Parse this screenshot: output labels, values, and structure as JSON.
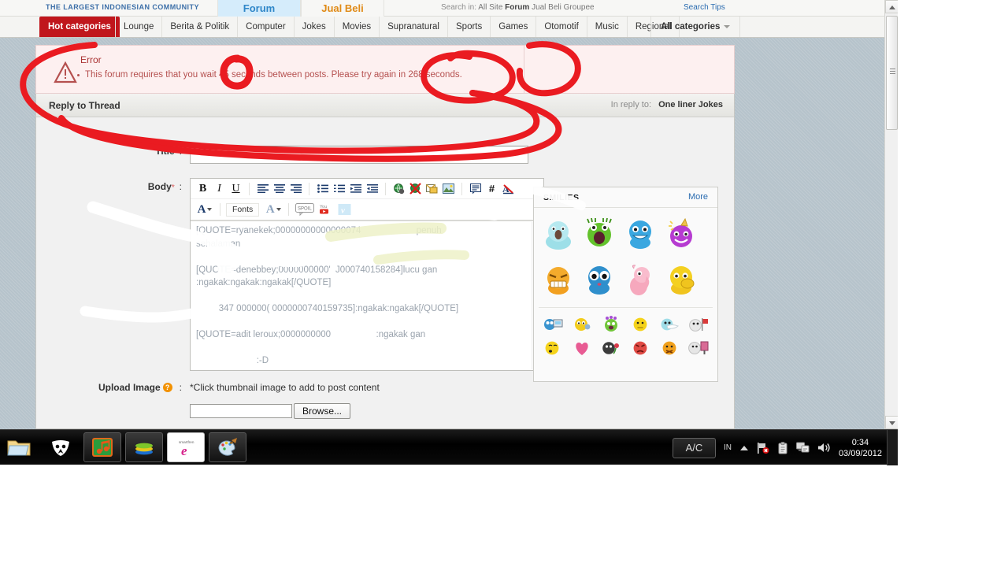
{
  "site": {
    "tagline": "THE LARGEST INDONESIAN COMMUNITY",
    "tab_forum": "Forum",
    "tab_jual_beli": "Jual Beli",
    "search_in_label": "Search in:",
    "search_scopes": [
      "All Site",
      "Forum",
      "Jual Beli",
      "Groupee"
    ],
    "search_tips": "Search Tips"
  },
  "categories": {
    "hot": "Hot categories",
    "items": [
      "Lounge",
      "Berita & Politik",
      "Computer",
      "Jokes",
      "Movies",
      "Supranatural",
      "Sports",
      "Games",
      "Otomotif",
      "Music",
      "Regional"
    ],
    "all": "All categories"
  },
  "error": {
    "heading": "Error",
    "message": "This forum requires that you wait 45 seconds between posts. Please try again in 268 seconds.",
    "wait_seconds": 45,
    "retry_seconds": 268
  },
  "reply": {
    "panel_title": "Reply to Thread",
    "in_reply_to_label": "In reply to:",
    "in_reply_to_thread": "One liner Jokes",
    "title_label": "Title",
    "title_value": "",
    "body_label": "Body",
    "body_required_mark": "*",
    "colon": ":",
    "body_value": "[QUOTE=ryanekek;00000000000000074                      penuh\nsehalaman\n\n[QUOTE=denebbey;0000000000'  J000740158284]lucu gan\n:ngakak:ngakak:ngakak[/QUOTE]\n\n         347 000000( 0000000740159735]:ngakak:ngakak[/QUOTE]\n\n[QUOTE=adit leroux;0000000000                  :ngakak gan\n\n                        :-D"
  },
  "toolbar": {
    "row1": [
      "bold-icon",
      "italic-icon",
      "underline-icon",
      "align-left-icon",
      "align-center-icon",
      "align-right-icon",
      "bullet-list-icon",
      "numbered-list-icon",
      "outdent-icon",
      "indent-icon",
      "link-icon",
      "unlink-icon",
      "email-icon",
      "image-icon",
      "quote-icon",
      "hash-icon",
      "remove-format-icon"
    ],
    "font_color_label": "A",
    "fonts_label": "Fonts",
    "font_size_label": "A",
    "spoil_label": "SPOIL",
    "youtube_label": "You",
    "vimeo_label": "v"
  },
  "smilies": {
    "title": "SMILIES",
    "more": "More",
    "big": [
      {
        "name": "shocked-cyan-smiley",
        "glyph": "😨"
      },
      {
        "name": "green-monster-smiley",
        "glyph": "😱"
      },
      {
        "name": "blue-grin-smiley",
        "glyph": "😀"
      },
      {
        "name": "purple-party-smiley",
        "glyph": "🥳"
      },
      {
        "name": "orange-evil-grin-smiley",
        "glyph": "😈"
      },
      {
        "name": "blue-bigeyes-smiley",
        "glyph": "🫢"
      },
      {
        "name": "pink-elephant-smiley",
        "glyph": "🐘"
      },
      {
        "name": "yellow-shy-smiley",
        "glyph": "🙊"
      }
    ],
    "small": [
      {
        "name": "computer-smiley",
        "glyph": "💻"
      },
      {
        "name": "thinking-smiley",
        "glyph": "🤔"
      },
      {
        "name": "flower-head-smiley",
        "glyph": "🌸"
      },
      {
        "name": "neutral-smiley",
        "glyph": "😐"
      },
      {
        "name": "sleep-smiley",
        "glyph": "😴"
      },
      {
        "name": "flag-smiley",
        "glyph": "🚩"
      },
      {
        "name": "whistle-smiley",
        "glyph": "😗"
      },
      {
        "name": "heart-smiley",
        "glyph": "❤"
      },
      {
        "name": "rose-smiley",
        "glyph": "🥀"
      },
      {
        "name": "angry-smiley",
        "glyph": "😡"
      },
      {
        "name": "silenced-smiley",
        "glyph": "🤐"
      },
      {
        "name": "mirror-smiley",
        "glyph": "🪞"
      }
    ]
  },
  "upload": {
    "label": "Upload Image",
    "colon": ":",
    "note": "*Click thumbnail image to add to post content",
    "file_value": "",
    "browse_label": "Browse..."
  },
  "taskbar": {
    "items": [
      {
        "name": "explorer-folder-icon",
        "glyph": "📁"
      },
      {
        "name": "foobar2000-icon",
        "glyph": "▼"
      },
      {
        "name": "music-player-icon",
        "glyph": "♬"
      },
      {
        "name": "bluestacks-icon",
        "glyph": "▤"
      },
      {
        "name": "smartfren-icon",
        "glyph": "e"
      },
      {
        "name": "paint-icon",
        "glyph": "🎨"
      }
    ],
    "ac_button": "A/C",
    "language": "IN",
    "time": "0:34",
    "date": "03/09/2012"
  },
  "colors": {
    "page_bg": "#b6c3cb",
    "hot_tab": "#c0161c",
    "error_bg": "#fdf0f0",
    "error_text": "#b5504f",
    "link": "#2b6cb0",
    "annotation_red": "#e8151b"
  }
}
